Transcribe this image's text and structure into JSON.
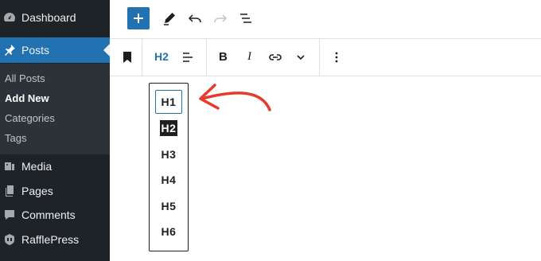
{
  "sidebar": {
    "items": [
      {
        "label": "Dashboard",
        "icon": "dashboard-icon"
      },
      {
        "label": "Posts",
        "icon": "pin-icon"
      },
      {
        "label": "Media",
        "icon": "media-icon"
      },
      {
        "label": "Pages",
        "icon": "pages-icon"
      },
      {
        "label": "Comments",
        "icon": "comment-icon"
      },
      {
        "label": "RafflePress",
        "icon": "rafflepress-icon"
      }
    ],
    "submenu": [
      "All Posts",
      "Add New",
      "Categories",
      "Tags"
    ],
    "current_submenu": "Add New"
  },
  "top_toolbar": {
    "icons": [
      "plus-icon",
      "pencil-icon",
      "undo-icon",
      "redo-icon",
      "list-view-icon"
    ]
  },
  "block_toolbar": {
    "heading_level": "H2",
    "bold": "B",
    "italic": "I",
    "icons": [
      "bookmark-icon",
      "align-icon",
      "link-icon",
      "chevron-down-icon",
      "more-options-icon"
    ]
  },
  "heading_dropdown": {
    "options": [
      "H1",
      "H2",
      "H3",
      "H4",
      "H5",
      "H6"
    ],
    "selected": "H2",
    "focused": "H1"
  },
  "colors": {
    "sidebar_bg": "#1d2327",
    "submenu_bg": "#2c3338",
    "accent": "#2271b1",
    "annotation_arrow": "#e8392b"
  }
}
